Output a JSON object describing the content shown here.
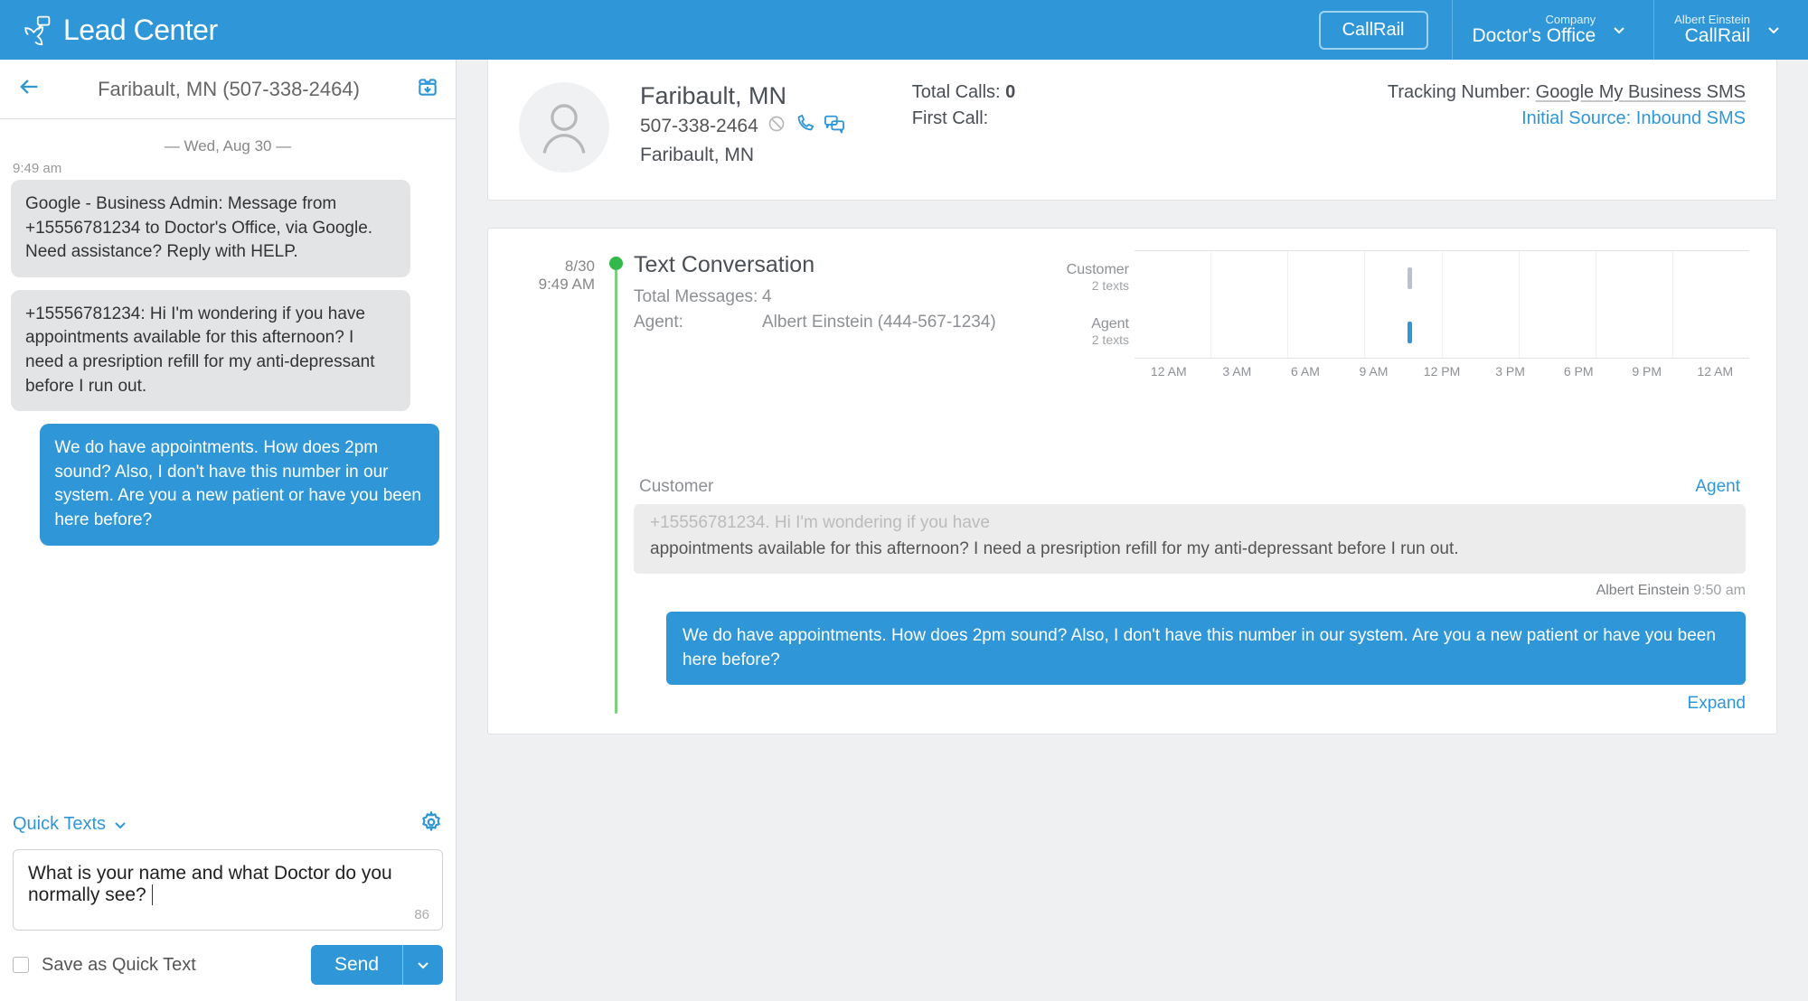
{
  "header": {
    "brand": "Lead Center",
    "button": "CallRail",
    "company": {
      "label": "Company",
      "value": "Doctor's Office"
    },
    "user": {
      "name": "Albert Einstein",
      "org": "CallRail"
    }
  },
  "left": {
    "title": "Faribault, MN (507-338-2464)",
    "date_sep": "— Wed, Aug 30 —",
    "time1": "9:49 am",
    "msg1": "Google - Business Admin: Message from +15556781234 to Doctor's Office, via Google. Need assistance? Reply with HELP.",
    "msg2": "+15556781234: Hi I'm wondering if you have appointments available for this afternoon? I need a presription refill for my anti-depressant before I run out.",
    "msg3": "We do have appointments. How does 2pm sound? Also, I don't have this number in our system. Are you a new patient or have you been here before?",
    "quick_texts": "Quick Texts",
    "compose_value": "What is your name and what Doctor do you normally see?",
    "counter": "86",
    "save_quick": "Save as Quick Text",
    "send": "Send"
  },
  "lead": {
    "name": "Faribault, MN",
    "phone": "507-338-2464",
    "location": "Faribault, MN",
    "total_calls_label": "Total Calls:",
    "total_calls_value": "0",
    "first_call_label": "First Call:",
    "first_call_value": "",
    "tracking_label": "Tracking Number:",
    "tracking_value": "Google My Business SMS",
    "source_label": "Initial Source:",
    "source_value": "Inbound SMS"
  },
  "conv": {
    "date": "8/30",
    "time": "9:49 AM",
    "title": "Text Conversation",
    "total_msgs_label": "Total Messages:",
    "total_msgs_value": "4",
    "agent_label": "Agent:",
    "agent_value": "Albert Einstein (444-567-1234)"
  },
  "chart_data": {
    "type": "bar",
    "xticks": [
      "12 AM",
      "3 AM",
      "6 AM",
      "9 AM",
      "12 PM",
      "3 PM",
      "6 PM",
      "9 PM",
      "12 AM"
    ],
    "series": [
      {
        "name": "Customer",
        "sub": "2 texts",
        "color": "#b8c1cc",
        "bars": [
          {
            "slot": 3,
            "height": 24
          }
        ]
      },
      {
        "name": "Agent",
        "sub": "2 texts",
        "color": "#2f97d8",
        "bars": [
          {
            "slot": 3,
            "height": 24
          }
        ]
      }
    ]
  },
  "thread": {
    "tab_customer": "Customer",
    "tab_agent": "Agent",
    "in_msg": "+15556781234: Hi I'm wondering if you have appointments available for this afternoon? I need a presription refill for my anti-depressant before I run out.",
    "out_meta_name": "Albert Einstein",
    "out_meta_time": "9:50 am",
    "out_msg": "We do have appointments. How does 2pm sound? Also, I don't have this number in our system. Are you a new patient or have you been here before?",
    "expand": "Expand"
  }
}
